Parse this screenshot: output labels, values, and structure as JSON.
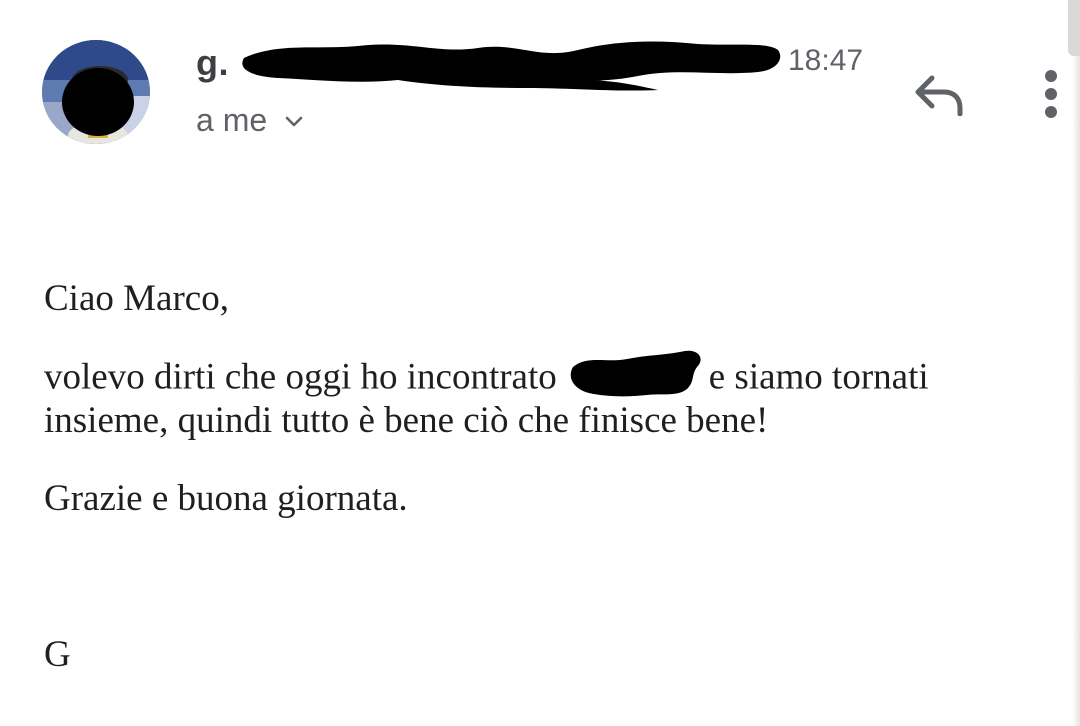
{
  "header": {
    "sender_name": "g.",
    "time": "18:47",
    "recipient_label": "a me"
  },
  "body": {
    "greeting": "Ciao Marco,",
    "line1_before": "volevo dirti che oggi ho incontrato",
    "line1_after": "e siamo tornati",
    "line2": "insieme, quindi tutto è bene ciò che finisce bene!",
    "closing": "Grazie e buona giornata.",
    "signature": "G"
  },
  "icons": {
    "reply": "reply-arrow-icon",
    "more": "more-vertical-icon",
    "expand": "chevron-down-icon"
  },
  "colors": {
    "text_primary": "#1f1f1f",
    "text_secondary": "#5f6368",
    "redaction": "#000000"
  }
}
